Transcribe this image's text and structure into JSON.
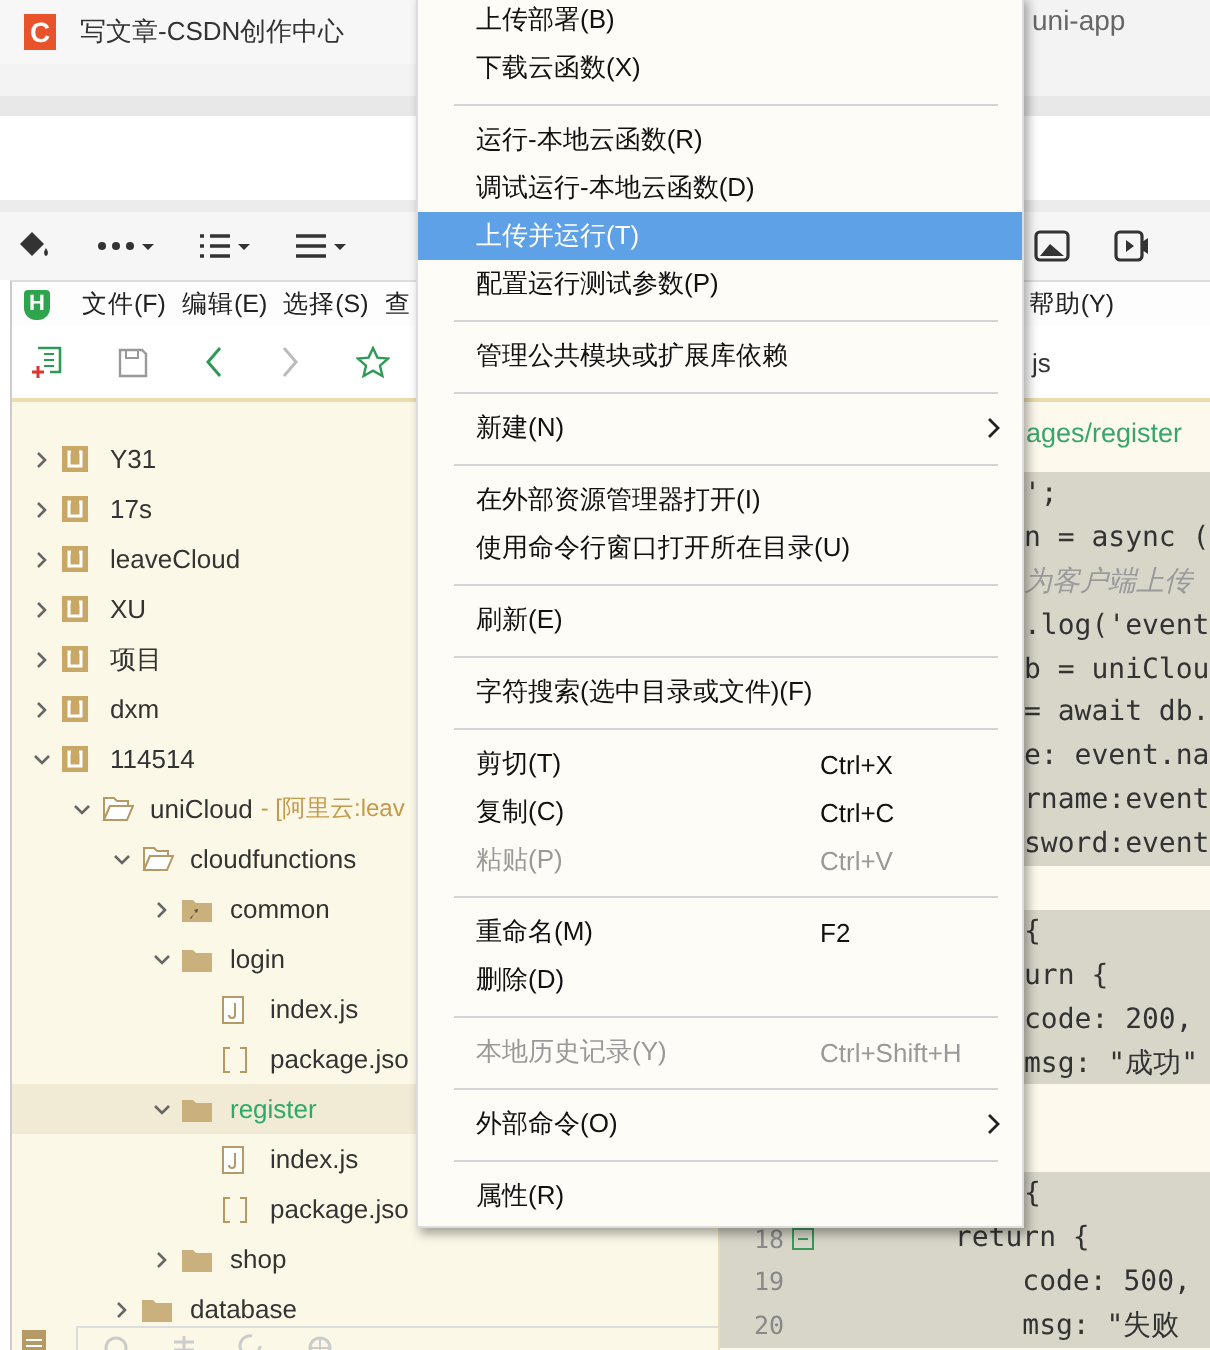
{
  "browser_tabs": [
    {
      "title": "写文章-CSDN创作中心",
      "icon_text": "C",
      "selected": true
    },
    {
      "title": "uni-app",
      "selected": false
    }
  ],
  "ide": {
    "logo": "H",
    "menus": [
      "文件(F)",
      "编辑(E)",
      "选择(S)",
      "查",
      "帮助(Y)"
    ],
    "editor_tab": "js",
    "breadcrumb": "ages/register"
  },
  "tree": [
    {
      "label": "Y31",
      "kind": "project",
      "expanded": false,
      "selected": false
    },
    {
      "label": "17s",
      "kind": "project",
      "expanded": false,
      "selected": false
    },
    {
      "label": "leaveCloud",
      "kind": "project",
      "expanded": false,
      "selected": false
    },
    {
      "label": "XU",
      "kind": "project",
      "expanded": false,
      "selected": false
    },
    {
      "label": "项目",
      "kind": "project",
      "expanded": false,
      "selected": false
    },
    {
      "label": "dxm",
      "kind": "project",
      "expanded": false,
      "selected": false
    },
    {
      "label": "114514",
      "kind": "project",
      "expanded": true,
      "selected": false,
      "children": [
        {
          "label": "uniCloud",
          "suffix": "- [阿里云:leav",
          "kind": "folder-open",
          "expanded": true,
          "selected": false,
          "children": [
            {
              "label": "cloudfunctions",
              "kind": "folder-open",
              "expanded": true,
              "selected": false,
              "children": [
                {
                  "label": "common",
                  "kind": "folder-special",
                  "expanded": false,
                  "selected": false
                },
                {
                  "label": "login",
                  "kind": "folder",
                  "expanded": true,
                  "selected": false,
                  "children": [
                    {
                      "label": "index.js",
                      "kind": "file-js",
                      "selected": false
                    },
                    {
                      "label": "package.jso",
                      "kind": "file-json",
                      "selected": false
                    }
                  ]
                },
                {
                  "label": "register",
                  "kind": "folder",
                  "expanded": true,
                  "selected": true,
                  "children": [
                    {
                      "label": "index.js",
                      "kind": "file-js",
                      "selected": false
                    },
                    {
                      "label": "package.jso",
                      "kind": "file-json",
                      "selected": false
                    }
                  ]
                },
                {
                  "label": "shop",
                  "kind": "folder",
                  "expanded": false,
                  "selected": false
                }
              ]
            },
            {
              "label": "database",
              "kind": "folder",
              "expanded": false,
              "selected": false
            }
          ]
        }
      ]
    }
  ],
  "code_lines": [
    {
      "text": "';",
      "highlighted": true
    },
    {
      "text": "n = async (",
      "highlighted": true
    },
    {
      "text": "为客户端上传",
      "kind": "comment",
      "highlighted": true
    },
    {
      "text": ".log('event",
      "highlighted": true
    },
    {
      "text": "b = uniClou",
      "highlighted": true
    },
    {
      "text": "= await db.",
      "highlighted": true
    },
    {
      "text": "e: event.na",
      "highlighted": true
    },
    {
      "text": "rname:event",
      "highlighted": true
    },
    {
      "text": "sword:event",
      "highlighted": true
    },
    {
      "highlighted": false
    },
    {
      "text": "{",
      "highlighted": true
    },
    {
      "text": "urn {",
      "highlighted": true
    },
    {
      "text": "code: 200,",
      "highlighted": true
    },
    {
      "text": "msg: \"成功\"",
      "highlighted": true
    },
    {
      "highlighted": false
    },
    {
      "highlighted": false
    },
    {
      "text": "{",
      "highlighted": true
    },
    {
      "number": "18",
      "text": "        return {",
      "foldable": true,
      "highlighted": true
    },
    {
      "number": "19",
      "text": "            code: 500,",
      "highlighted": true
    },
    {
      "number": "20",
      "text": "            msg: \"失败",
      "highlighted": true
    }
  ],
  "context_menu": [
    {
      "kind": "item",
      "label": "上传部署(B)",
      "disabled": false,
      "selected": false
    },
    {
      "kind": "item",
      "label": "下载云函数(X)",
      "disabled": false,
      "selected": false
    },
    {
      "kind": "separator"
    },
    {
      "kind": "item",
      "label": "运行-本地云函数(R)",
      "disabled": false,
      "selected": false
    },
    {
      "kind": "item",
      "label": "调试运行-本地云函数(D)",
      "disabled": false,
      "selected": false
    },
    {
      "kind": "item",
      "label": "上传并运行(T)",
      "disabled": false,
      "selected": true
    },
    {
      "kind": "item",
      "label": "配置运行测试参数(P)",
      "disabled": false,
      "selected": false
    },
    {
      "kind": "separator"
    },
    {
      "kind": "item",
      "label": "管理公共模块或扩展库依赖",
      "disabled": false,
      "selected": false
    },
    {
      "kind": "separator"
    },
    {
      "kind": "item",
      "label": "新建(N)",
      "submenu": true,
      "disabled": false,
      "selected": false
    },
    {
      "kind": "separator"
    },
    {
      "kind": "item",
      "label": "在外部资源管理器打开(I)",
      "disabled": false,
      "selected": false
    },
    {
      "kind": "item",
      "label": "使用命令行窗口打开所在目录(U)",
      "disabled": false,
      "selected": false
    },
    {
      "kind": "separator"
    },
    {
      "kind": "item",
      "label": "刷新(E)",
      "disabled": false,
      "selected": false
    },
    {
      "kind": "separator"
    },
    {
      "kind": "item",
      "label": "字符搜索(选中目录或文件)(F)",
      "disabled": false,
      "selected": false
    },
    {
      "kind": "separator"
    },
    {
      "kind": "item",
      "label": "剪切(T)",
      "shortcut": "Ctrl+X",
      "disabled": false,
      "selected": false
    },
    {
      "kind": "item",
      "label": "复制(C)",
      "shortcut": "Ctrl+C",
      "disabled": false,
      "selected": false
    },
    {
      "kind": "item",
      "label": "粘贴(P)",
      "shortcut": "Ctrl+V",
      "disabled": true,
      "selected": false
    },
    {
      "kind": "separator"
    },
    {
      "kind": "item",
      "label": "重命名(M)",
      "shortcut": "F2",
      "disabled": false,
      "selected": false
    },
    {
      "kind": "item",
      "label": "删除(D)",
      "disabled": false,
      "selected": false
    },
    {
      "kind": "separator"
    },
    {
      "kind": "item",
      "label": "本地历史记录(Y)",
      "shortcut": "Ctrl+Shift+H",
      "disabled": true,
      "selected": false
    },
    {
      "kind": "separator"
    },
    {
      "kind": "item",
      "label": "外部命令(O)",
      "submenu": true,
      "disabled": false,
      "selected": false
    },
    {
      "kind": "separator"
    },
    {
      "kind": "item",
      "label": "属性(R)",
      "disabled": false,
      "selected": false
    }
  ]
}
